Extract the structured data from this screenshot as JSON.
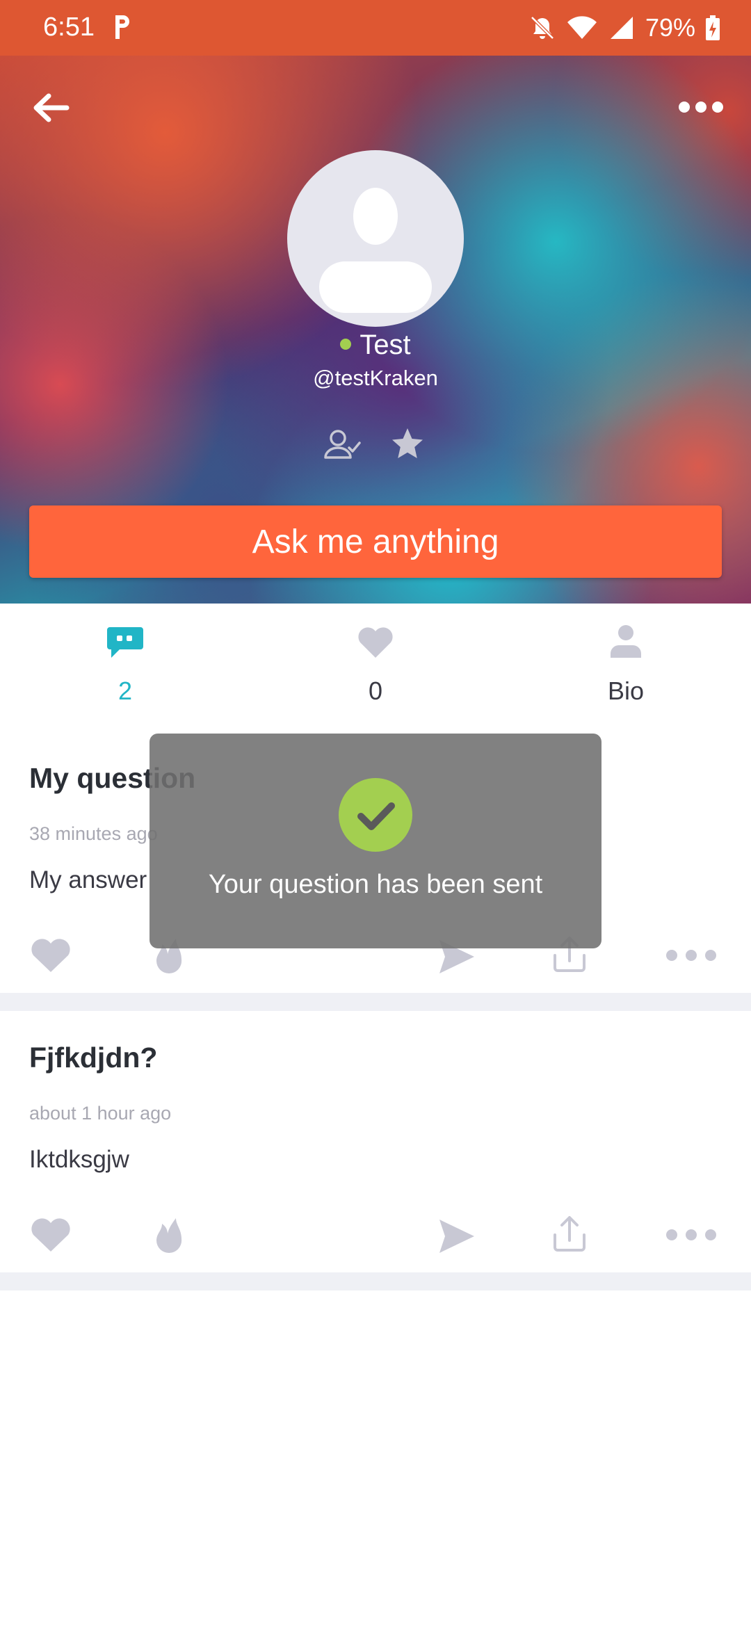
{
  "status_bar": {
    "time": "6:51",
    "battery": "79%",
    "icons": [
      "parking-app-icon",
      "bell-off-icon",
      "wifi-icon",
      "signal-icon",
      "battery-charging-icon"
    ]
  },
  "header": {
    "back_icon": "arrow-left-icon",
    "more_icon": "more-horizontal-icon",
    "name": "Test",
    "handle": "@testKraken",
    "online_color": "#a3cf50",
    "ask_button": "Ask me anything",
    "ask_color": "#ff653c"
  },
  "tabs": [
    {
      "icon": "chat-bubble-icon",
      "label": "2",
      "active": true
    },
    {
      "icon": "heart-icon",
      "label": "0",
      "active": false
    },
    {
      "icon": "person-icon",
      "label": "Bio",
      "active": false
    }
  ],
  "questions": [
    {
      "title": "My question",
      "time": "38 minutes ago",
      "answer": "My answer"
    },
    {
      "title": "Fjfkdjdn?",
      "time": "about 1 hour ago",
      "answer": "Iktdksgjw"
    }
  ],
  "toast": {
    "message": "Your question has been sent",
    "icon": "check-icon",
    "check_color": "#a3cf50"
  },
  "colors": {
    "accent": "#21b5c6",
    "status_bar": "#de5732",
    "icon_gray": "#c8c8d4"
  }
}
